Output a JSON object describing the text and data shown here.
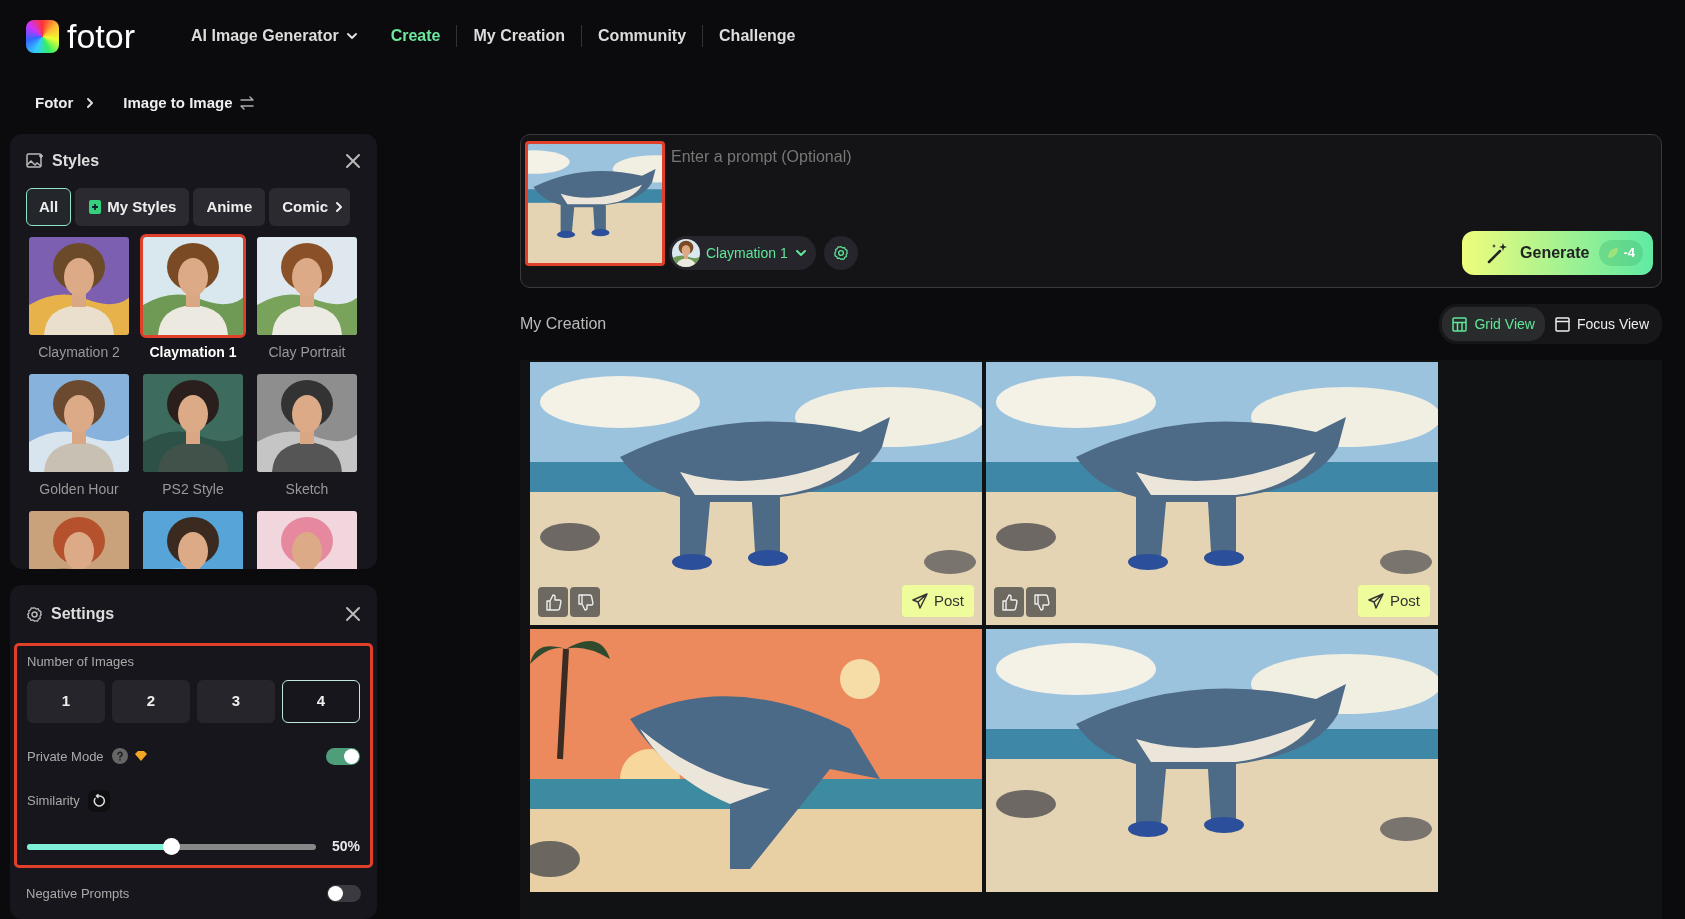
{
  "header": {
    "logo": "fotor",
    "nav": [
      {
        "label": "AI Image Generator",
        "kind": "dropdown",
        "selected": false
      },
      {
        "label": "Create",
        "kind": "link",
        "selected": true
      },
      {
        "label": "My Creation",
        "kind": "link",
        "selected": false
      },
      {
        "label": "Community",
        "kind": "link",
        "selected": false
      },
      {
        "label": "Challenge",
        "kind": "link",
        "selected": false
      }
    ]
  },
  "breadcrumb": [
    {
      "label": "Fotor"
    },
    {
      "label": "Image to Image"
    }
  ],
  "styles_panel": {
    "title": "Styles",
    "filters": [
      {
        "label": "All",
        "selected": true
      },
      {
        "label": "My Styles",
        "selected": false
      },
      {
        "label": "Anime",
        "selected": false
      },
      {
        "label": "Comic",
        "selected": false
      }
    ],
    "items": [
      {
        "label": "Claymation 2",
        "selected": false
      },
      {
        "label": "Claymation 1",
        "selected": true
      },
      {
        "label": "Clay Portrait",
        "selected": false
      },
      {
        "label": "Golden Hour",
        "selected": false
      },
      {
        "label": "PS2 Style",
        "selected": false
      },
      {
        "label": "Sketch",
        "selected": false
      },
      {
        "selected": false
      },
      {
        "selected": false
      },
      {
        "selected": false
      }
    ]
  },
  "settings_panel": {
    "title": "Settings",
    "number_of_images": {
      "label": "Number of Images",
      "options": [
        {
          "label": "1",
          "selected": false
        },
        {
          "label": "2",
          "selected": false
        },
        {
          "label": "3",
          "selected": false
        },
        {
          "label": "4",
          "selected": true
        }
      ]
    },
    "private_mode": {
      "label": "Private Mode",
      "on": true
    },
    "similarity": {
      "label": "Similarity",
      "level": 0.5,
      "reading": "50%"
    },
    "negative_prompts": {
      "label": "Negative Prompts",
      "on": false
    }
  },
  "prompt": {
    "placeholder": "Enter a prompt (Optional)",
    "style_chip": "Claymation 1",
    "generate": {
      "label": "Generate",
      "cost": "-4"
    }
  },
  "creation": {
    "title": "My Creation",
    "views": [
      {
        "label": "Grid View",
        "kind": "grid",
        "selected": true
      },
      {
        "label": "Focus View",
        "kind": "focus",
        "selected": false
      }
    ],
    "images": [
      {
        "kind": "picture",
        "post": "Post"
      },
      {
        "kind": "picture",
        "post": "Post"
      },
      {
        "kind": "picture"
      },
      {
        "kind": "picture"
      }
    ]
  }
}
